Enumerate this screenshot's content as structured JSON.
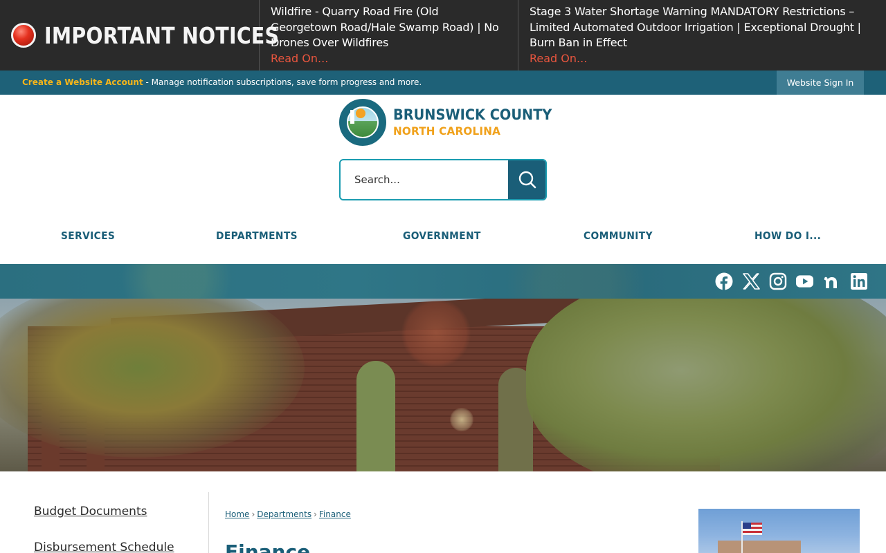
{
  "notices": {
    "title": "IMPORTANT NOTICES",
    "items": [
      {
        "text": "Wildfire - Quarry Road Fire (Old Georgetown Road/Hale Swamp Road) | No Drones Over Wildfires",
        "link": "Read On..."
      },
      {
        "text": "Stage 3 Water Shortage Warning MANDATORY Restrictions – Limited Automated Outdoor Irrigation | Exceptional Drought | Burn Ban in Effect",
        "link": "Read On..."
      }
    ]
  },
  "account_bar": {
    "create_link": "Create a Website Account",
    "message": " - Manage notification subscriptions, save form progress and more.",
    "signin_label": "Website Sign In"
  },
  "logo": {
    "name": "BRUNSWICK COUNTY",
    "state": "NORTH CAROLINA"
  },
  "search": {
    "placeholder": "Search..."
  },
  "main_nav": {
    "items": [
      "SERVICES",
      "DEPARTMENTS",
      "GOVERNMENT",
      "COMMUNITY",
      "HOW DO I..."
    ]
  },
  "social": {
    "icons": [
      "facebook-icon",
      "x-icon",
      "instagram-icon",
      "youtube-icon",
      "nextdoor-icon",
      "linkedin-icon"
    ]
  },
  "side_nav": {
    "items": [
      "Budget Documents",
      "Disbursement Schedule"
    ]
  },
  "breadcrumb": {
    "items": [
      "Home",
      "Departments",
      "Finance"
    ],
    "separator": "›"
  },
  "page": {
    "title": "Finance"
  },
  "colors": {
    "brand_teal": "#1a5e78",
    "accent_orange": "#f0a11b",
    "notice_bg": "#2a2a2a",
    "read_on_link": "#e8553e",
    "account_link": "#f5b51a"
  }
}
